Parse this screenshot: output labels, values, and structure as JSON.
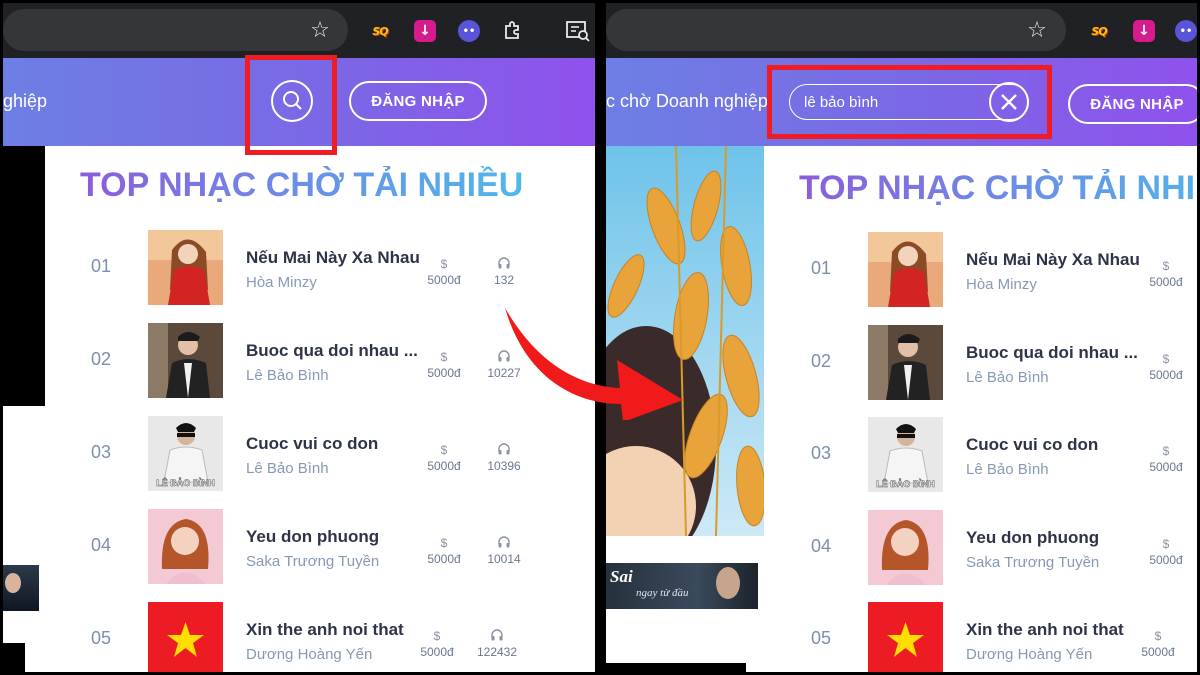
{
  "colors": {
    "header_start": "#6d7fe4",
    "header_end": "#8f52ec",
    "highlight": "#ef1c24",
    "title_start": "#8b5cdd",
    "title_end": "#4fb8ea",
    "rank": "#7d8fb0",
    "song": "#2e3447",
    "artist": "#8799b4"
  },
  "icons": {
    "star": "bookmark-star-icon",
    "sq": "sq-extension-icon",
    "download": "download-extension-icon",
    "bot": "bot-extension-icon",
    "puzzle": "extensions-puzzle-icon",
    "reading": "reading-mode-icon",
    "search": "search-icon",
    "clear": "close-icon",
    "price": "dollar-icon",
    "listen": "headphones-icon"
  },
  "left": {
    "nav_text": "ghiệp",
    "login": "ĐĂNG NHẬP",
    "section_title": "TOP NHẠC CHỜ TẢI NHIỀU",
    "songs": [
      {
        "rank": "01",
        "title": "Nếu Mai Này Xa Nhau",
        "artist": "Hòa Minzy",
        "price": "5000đ",
        "plays": "132"
      },
      {
        "rank": "02",
        "title": "Buoc qua doi nhau ...",
        "artist": "Lê Bảo Bình",
        "price": "5000đ",
        "plays": "10227"
      },
      {
        "rank": "03",
        "title": "Cuoc vui co don",
        "artist": "Lê Bảo Bình",
        "price": "5000đ",
        "plays": "10396"
      },
      {
        "rank": "04",
        "title": "Yeu don phuong",
        "artist": "Saka Trương Tuyền",
        "price": "5000đ",
        "plays": "10014"
      },
      {
        "rank": "05",
        "title": "Xin the anh noi that",
        "artist": "Dương Hoàng Yến",
        "price": "5000đ",
        "plays": "122432"
      }
    ],
    "thumb_03_label": "LÊ BẢO BÌNH"
  },
  "right": {
    "nav_text": "c chờ Doanh nghiệp",
    "search_value": "lê bảo bình",
    "login": "ĐĂNG NHẬP",
    "section_title": "TOP NHẠC CHỜ TẢI NHIỀU",
    "songs": [
      {
        "rank": "01",
        "title": "Nếu Mai Này Xa Nhau",
        "artist": "Hòa Minzy",
        "price": "5000đ"
      },
      {
        "rank": "02",
        "title": "Buoc qua doi nhau ...",
        "artist": "Lê Bảo Bình",
        "price": "5000đ"
      },
      {
        "rank": "03",
        "title": "Cuoc vui co don",
        "artist": "Lê Bảo Bình",
        "price": "5000đ"
      },
      {
        "rank": "04",
        "title": "Yeu don phuong",
        "artist": "Saka Trương Tuyền",
        "price": "5000đ"
      },
      {
        "rank": "05",
        "title": "Xin the anh noi that",
        "artist": "Dương Hoàng Yến",
        "price": "5000đ"
      }
    ],
    "thumb_03_label": "LÊ BẢO BÌNH",
    "banner_text": "Sai",
    "banner_sub": "ngay từ đầu"
  },
  "price_symbol": "$",
  "ext_sq_label": "SQ"
}
